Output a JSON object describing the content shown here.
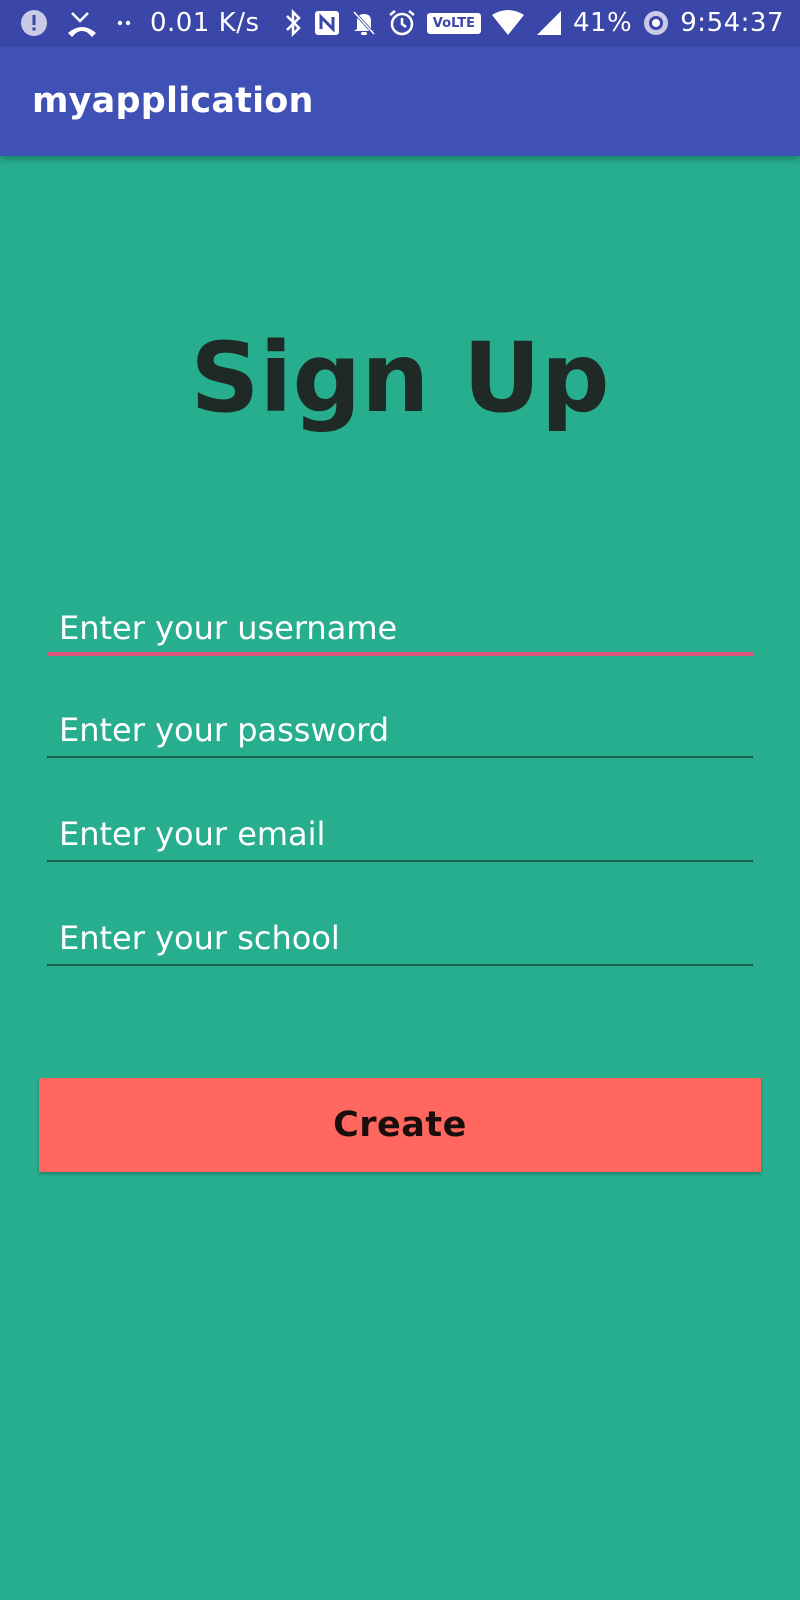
{
  "status_bar": {
    "network_speed": "0.01 K/s",
    "volte_label": "VoLTE",
    "battery_percent": "41%",
    "time": "9:54:37",
    "icons": [
      "alert-icon",
      "missed-call-icon",
      "dots-icon",
      "bluetooth-icon",
      "nfc-icon",
      "bell-off-icon",
      "alarm-icon",
      "volte-icon",
      "wifi-icon",
      "signal-icon",
      "battery-saver-icon"
    ]
  },
  "app_bar": {
    "title": "myapplication"
  },
  "form": {
    "heading": "Sign Up",
    "fields": [
      {
        "placeholder": "Enter your username",
        "value": ""
      },
      {
        "placeholder": "Enter your password",
        "value": ""
      },
      {
        "placeholder": "Enter your email",
        "value": ""
      },
      {
        "placeholder": "Enter your school",
        "value": ""
      }
    ],
    "submit_label": "Create"
  },
  "colors": {
    "status_bar": "#3a46a8",
    "app_bar": "#3f51b5",
    "background": "#26ae8f",
    "focus_underline": "#d9567a",
    "button": "#ff675f"
  }
}
